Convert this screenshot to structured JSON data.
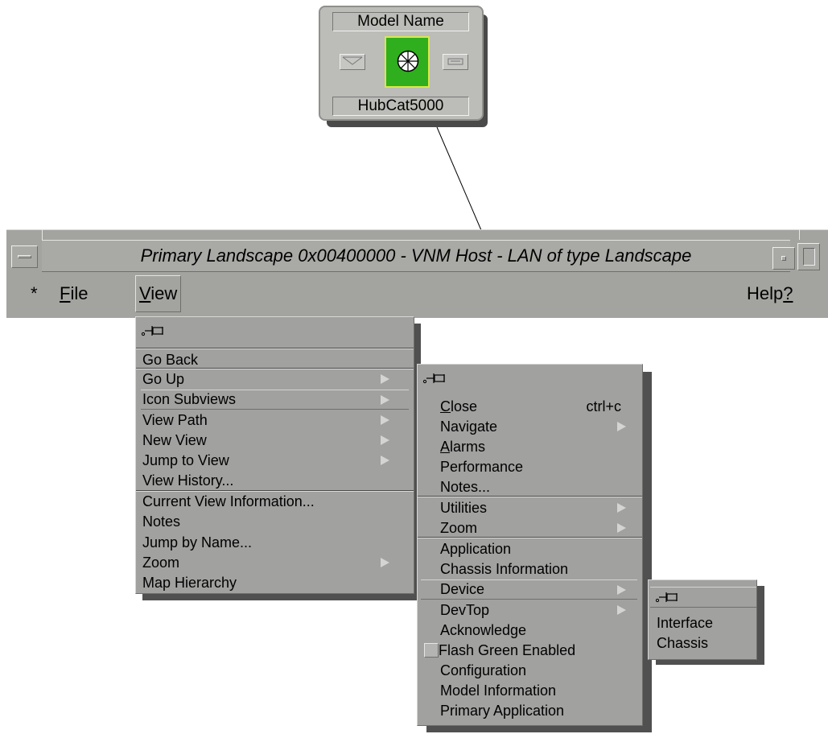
{
  "model_icon": {
    "model_name": "Model Name",
    "device_label": "HubCat5000"
  },
  "window": {
    "title": "Primary Landscape 0x00400000 - VNM Host - LAN of type Landscape"
  },
  "menubar": {
    "star": "*",
    "file": {
      "mnemonic": "F",
      "rest": "ile"
    },
    "view": {
      "mnemonic": "V",
      "rest": "iew"
    },
    "help": {
      "text": "Help",
      "mnemonic": "?"
    }
  },
  "view_menu": {
    "items": [
      "Go Back",
      "Go Up",
      "Icon Subviews",
      "View Path",
      "New View",
      "Jump to View",
      "View History...",
      "Current View Information...",
      "Notes",
      "Jump by Name...",
      "Zoom",
      "Map Hierarchy"
    ]
  },
  "icon_subviews_menu": {
    "close": {
      "mnemonic": "C",
      "rest": "lose",
      "accelerator": "ctrl+c"
    },
    "navigate": "Navigate",
    "alarms": {
      "mnemonic": "A",
      "rest": "larms"
    },
    "items": [
      "Performance",
      "Notes...",
      "Utilities",
      "Zoom",
      "Application",
      "Chassis Information",
      "Device",
      "DevTop",
      "Acknowledge",
      "Flash Green Enabled",
      "Configuration",
      "Model Information",
      "Primary Application"
    ]
  },
  "device_menu": {
    "items": [
      "Interface",
      "Chassis"
    ]
  },
  "colors": {
    "menu_bg": "#a1a1a0",
    "icon_bg": "#bcbcb8",
    "status_green": "#2fae1e",
    "window_frame": "#a3a3a0"
  }
}
